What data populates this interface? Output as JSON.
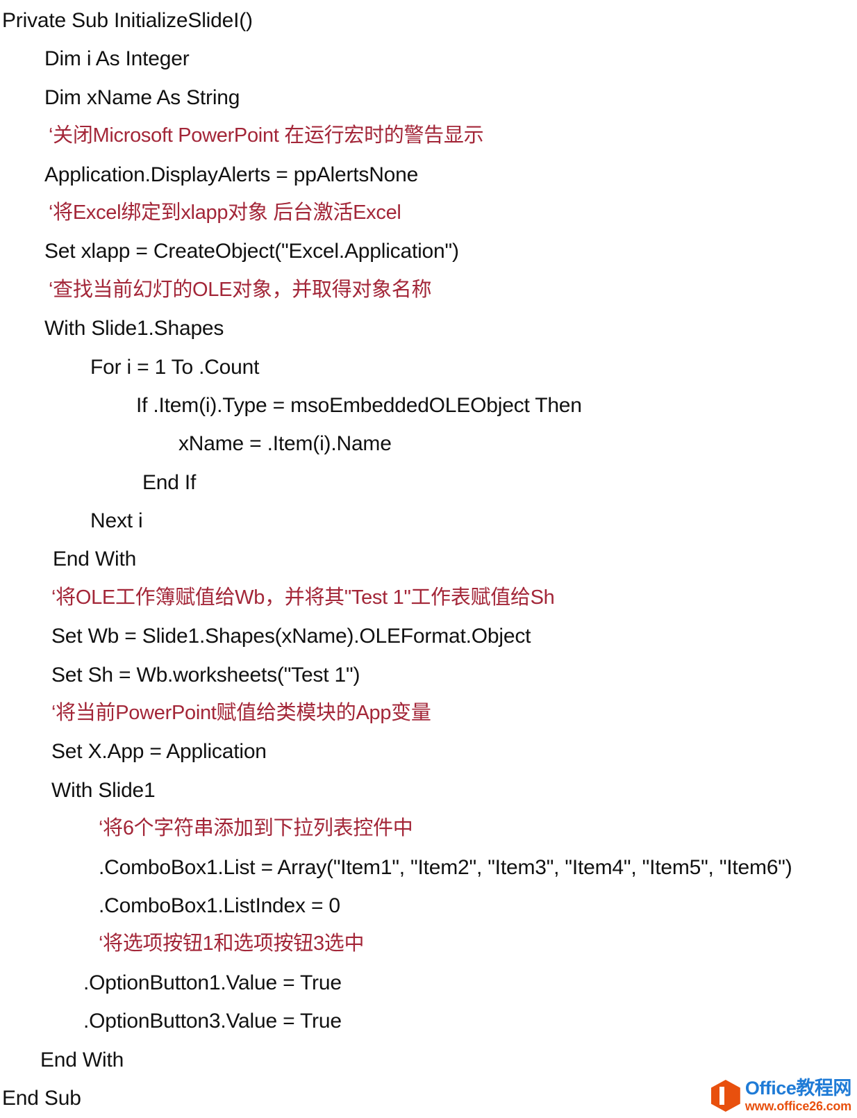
{
  "document": {
    "kind": "vba-code-listing",
    "language": "VBA",
    "background_color": "#FFFFFF",
    "code_color": "#111111",
    "comment_color": "#A32638"
  },
  "code": {
    "lines": [
      {
        "text": "Private Sub InitializeSlideI()",
        "type": "code",
        "indent": 0
      },
      {
        "text": "Dim i As Integer",
        "type": "code",
        "indent": 1
      },
      {
        "text": "Dim xName As String",
        "type": "code",
        "indent": 1
      },
      {
        "text": "‘关闭Microsoft PowerPoint 在运行宏时的警告显示",
        "type": "comment",
        "indent": 2
      },
      {
        "text": "Application.DisplayAlerts = ppAlertsNone",
        "type": "code",
        "indent": 1
      },
      {
        "text": "‘将Excel绑定到xlapp对象 后台激活Excel",
        "type": "comment",
        "indent": 2
      },
      {
        "text": "Set xlapp = CreateObject(\"Excel.Application\")",
        "type": "code",
        "indent": 1
      },
      {
        "text": "‘查找当前幻灯的OLE对象，并取得对象名称",
        "type": "comment",
        "indent": 2
      },
      {
        "text": "With Slide1.Shapes",
        "type": "code",
        "indent": 1
      },
      {
        "text": "For i = 1 To .Count",
        "type": "code",
        "indent": 4
      },
      {
        "text": "If .Item(i).Type = msoEmbeddedOLEObject Then",
        "type": "code",
        "indent": 5
      },
      {
        "text": "xName = .Item(i).Name",
        "type": "code",
        "indent": 6
      },
      {
        "text": "End If",
        "type": "code",
        "indent": 7
      },
      {
        "text": "Next i",
        "type": "code",
        "indent": 8
      },
      {
        "text": "End With",
        "type": "code",
        "indent": 9
      },
      {
        "text": "‘将OLE工作簿赋值给Wb，并将其\"Test 1\"工作表赋值给Sh",
        "type": "comment",
        "indent": 3
      },
      {
        "text": "Set Wb = Slide1.Shapes(xName).OLEFormat.Object",
        "type": "code",
        "indent": 3
      },
      {
        "text": "Set Sh = Wb.worksheets(\"Test 1\")",
        "type": "code",
        "indent": 3
      },
      {
        "text": "‘将当前PowerPoint赋值给类模块的App变量",
        "type": "comment",
        "indent": 3
      },
      {
        "text": "Set X.App = Application",
        "type": "code",
        "indent": 3
      },
      {
        "text": "With Slide1",
        "type": "code",
        "indent": 3
      },
      {
        "text": "‘将6个字符串添加到下拉列表控件中",
        "type": "comment",
        "indent": 10
      },
      {
        "text": ".ComboBox1.List = Array(\"Item1\", \"Item2\", \"Item3\", \"Item4\", \"Item5\", \"Item6\")",
        "type": "code",
        "indent": 10
      },
      {
        "text": ".ComboBox1.ListIndex = 0",
        "type": "code",
        "indent": 10
      },
      {
        "text": "‘将选项按钮1和选项按钮3选中",
        "type": "comment",
        "indent": 10
      },
      {
        "text": ".OptionButton1.Value = True",
        "type": "code",
        "indent": 11
      },
      {
        "text": ".OptionButton3.Value = True",
        "type": "code",
        "indent": 11
      },
      {
        "text": "End With",
        "type": "code",
        "indent": 12
      },
      {
        "text": "End Sub",
        "type": "code",
        "indent": 0
      }
    ]
  },
  "watermark": {
    "site_name": "Office教程网",
    "site_url": "www.office26.com",
    "badge_color": "#E8500E",
    "title_color": "#1F7BD6",
    "url_color": "#E8500E"
  }
}
